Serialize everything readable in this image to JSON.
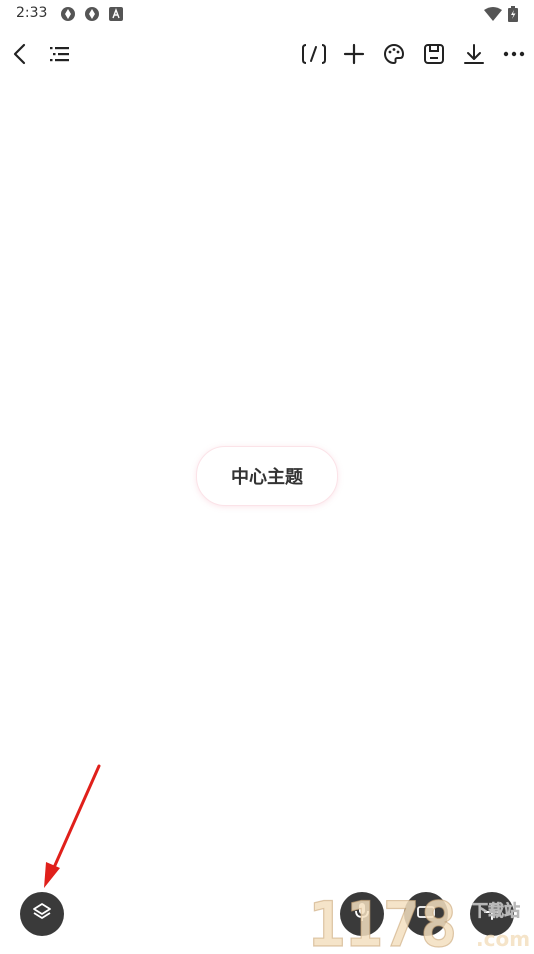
{
  "status_bar": {
    "time": "2:33",
    "left_icons": [
      "sync-icon",
      "sync-icon",
      "font-a-icon"
    ],
    "right_icons": [
      "wifi-icon",
      "battery-icon"
    ]
  },
  "toolbar": {
    "left": [
      "back-icon",
      "outline-list-icon"
    ],
    "right": [
      "formula-icon",
      "add-icon",
      "palette-icon",
      "save-icon",
      "download-icon",
      "more-icon"
    ]
  },
  "canvas": {
    "central_topic": "中心主题",
    "accent_color": "#f6b7c5"
  },
  "bottom_bar": {
    "layers_button_icon": "layers-icon",
    "right_buttons": [
      "microphone-icon",
      "node-icon",
      "add-node-icon"
    ]
  },
  "annotation": {
    "arrow_color": "#e0201b"
  },
  "watermark": {
    "text": "1178",
    "sub_text": "下载站",
    "domain": ".com"
  }
}
